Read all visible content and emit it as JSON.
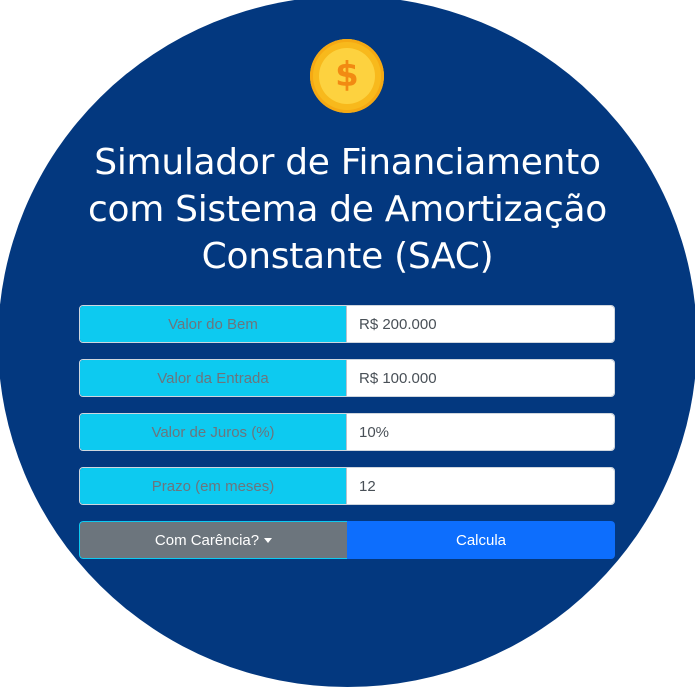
{
  "icon": {
    "name": "dollar-coin-icon",
    "glyph": "$",
    "colors": {
      "outer": "#f8b91c",
      "inner": "#fdd23f",
      "symbol": "#f28a12"
    }
  },
  "title": {
    "line1": "Simulador de Financiamento",
    "line2": "com Sistema de Amortização",
    "line3": "Constante (SAC)"
  },
  "form": {
    "valor_bem": {
      "label": "Valor do Bem",
      "value": "R$ 200.000"
    },
    "valor_entrada": {
      "label": "Valor da Entrada",
      "value": "R$ 100.000"
    },
    "valor_juros": {
      "label": "Valor de Juros (%)",
      "value": "10%"
    },
    "prazo": {
      "label": "Prazo (em meses)",
      "value": "12"
    }
  },
  "buttons": {
    "carencia_label": "Com Carência?",
    "calcula_label": "Calcula"
  },
  "colors": {
    "background_circle": "#03387f",
    "label_bg": "#0dcaf0",
    "secondary_button": "#6c757d",
    "primary_button": "#0d6efd"
  }
}
